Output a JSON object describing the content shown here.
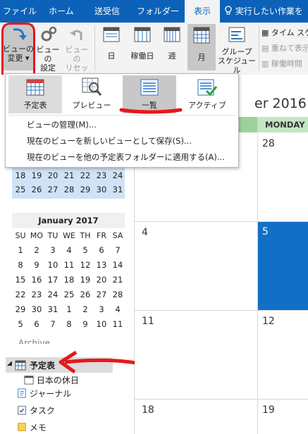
{
  "ribbon_tabs": {
    "file": "ファイル",
    "home": "ホーム",
    "send_receive": "送受信",
    "folder": "フォルダー",
    "view": "表示",
    "tell_me": "実行したい作業を入"
  },
  "ribbon": {
    "change_view_l1": "ビューの",
    "change_view_l2": "変更",
    "view_settings_l1": "ビューの",
    "view_settings_l2": "設定",
    "reset_view_l1": "ビューの",
    "reset_view_l2": "リセット",
    "day": "日",
    "work_week": "稼働日",
    "week": "週",
    "month": "月",
    "schedule_l1": "グループ",
    "schedule_l2": "スケジュール",
    "time_scale": "タイム スケ",
    "overlay": "重ねて表示",
    "working_hours": "稼働時間"
  },
  "dropdown": {
    "views": [
      {
        "label": "予定表"
      },
      {
        "label": "プレビュー"
      },
      {
        "label": "一覧"
      },
      {
        "label": "アクティブ"
      }
    ],
    "manage_views": "ビューの管理(M)...",
    "save_view": "現在のビューを新しいビューとして保存(S)...",
    "apply_view": "現在のビューを他の予定表フォルダーに適用する(A)..."
  },
  "mini_calendar_top": {
    "row1": [
      "18",
      "19",
      "20",
      "21",
      "22",
      "23",
      "24"
    ],
    "row2": [
      "25",
      "26",
      "27",
      "28",
      "29",
      "30",
      "31"
    ]
  },
  "mini_calendar": {
    "title": "January 2017",
    "weekdays": [
      "SU",
      "MO",
      "TU",
      "WE",
      "TH",
      "FR",
      "SA"
    ],
    "weeks": [
      [
        "1",
        "2",
        "3",
        "4",
        "5",
        "6",
        "7"
      ],
      [
        "8",
        "9",
        "10",
        "11",
        "12",
        "13",
        "14"
      ],
      [
        "15",
        "16",
        "17",
        "18",
        "19",
        "20",
        "21"
      ],
      [
        "22",
        "23",
        "24",
        "25",
        "26",
        "27",
        "28"
      ],
      [
        "29",
        "30",
        "31",
        "1",
        "2",
        "3",
        "4"
      ],
      [
        "5",
        "6",
        "7",
        "8",
        "9",
        "10",
        "11"
      ]
    ]
  },
  "nav": {
    "archive_partial": "Archive",
    "calendar_folder": "予定表",
    "japan_holidays": "日本の休日",
    "journal": "ジャーナル",
    "tasks": "タスク",
    "notes": "メモ"
  },
  "calendar": {
    "month_title": "er 2016",
    "monday_header": "MONDAY",
    "days": [
      "28",
      "4",
      "5",
      "11",
      "12",
      "18",
      "19"
    ]
  },
  "colors": {
    "ribbon_blue": "#0b62b8",
    "today_blue": "#1170c6",
    "monday_green": "#9bd29b",
    "annotation_red": "#e8161c"
  }
}
